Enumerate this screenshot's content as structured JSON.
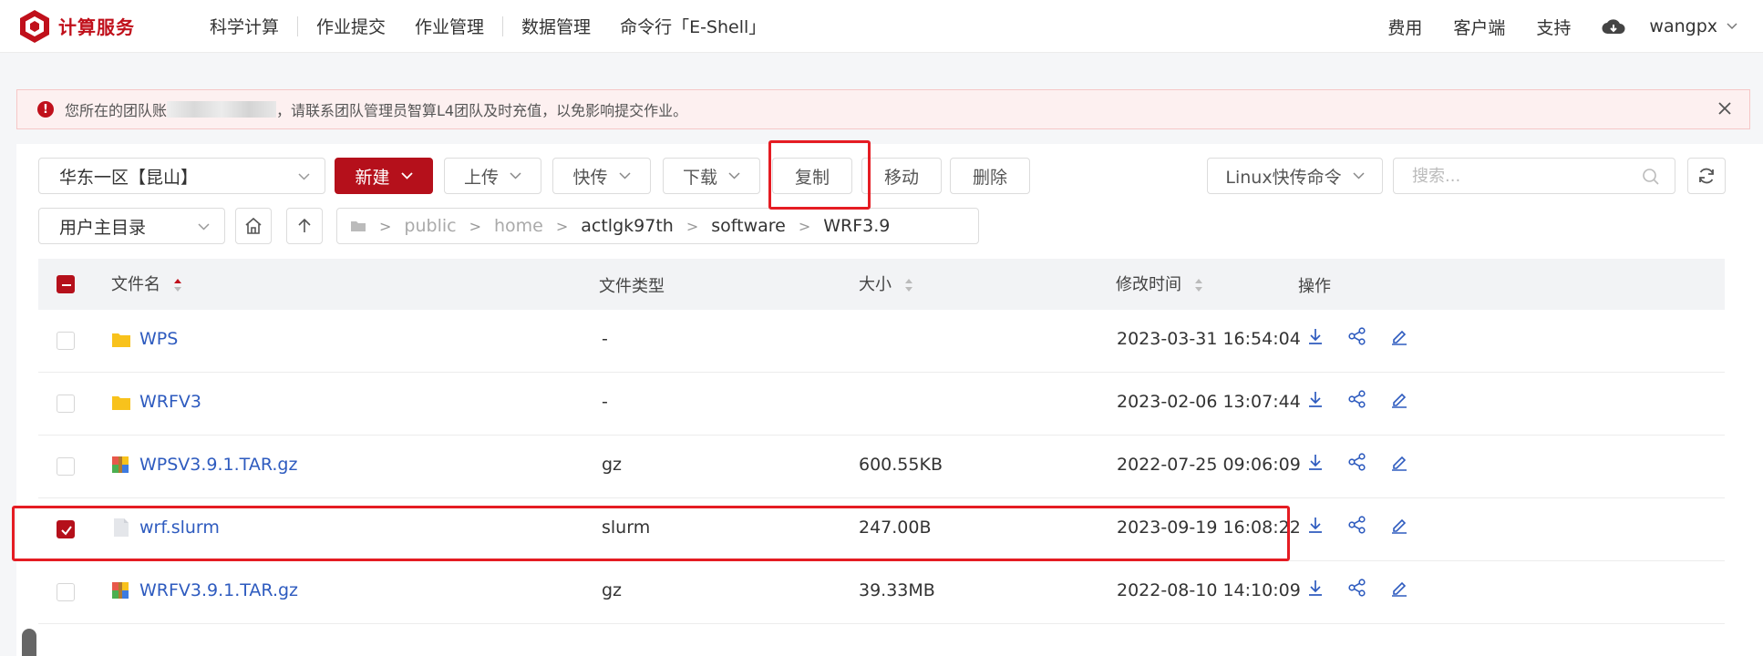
{
  "header": {
    "logo_text": "计算服务",
    "nav": [
      "科学计算",
      "作业提交",
      "作业管理",
      "数据管理",
      "命令行「E-Shell」"
    ],
    "right": [
      "费用",
      "客户端",
      "支持"
    ],
    "user": "wangpx"
  },
  "alert": {
    "text_before": "您所在的团队账",
    "text_after": "，请联系团队管理员智算L4团队及时充值，以免影响提交作业。"
  },
  "toolbar": {
    "region": "华东一区【昆山】",
    "new": "新建",
    "upload": "上传",
    "fast_transfer": "快传",
    "download": "下载",
    "copy": "复制",
    "move": "移动",
    "delete": "删除",
    "linux_cmd": "Linux快传命令",
    "search_placeholder": "搜索..."
  },
  "path_bar": {
    "dir_select": "用户主目录",
    "crumbs": [
      "public",
      "home",
      "actlgk97th",
      "software",
      "WRF3.9"
    ]
  },
  "table": {
    "headers": {
      "name": "文件名",
      "type": "文件类型",
      "size": "大小",
      "mtime": "修改时间",
      "ops": "操作"
    },
    "rows": [
      {
        "name": "WPS",
        "type": "-",
        "size": "",
        "mtime": "2023-03-31 16:54:04",
        "icon": "folder-icon",
        "checked": false
      },
      {
        "name": "WRFV3",
        "type": "-",
        "size": "",
        "mtime": "2023-02-06 13:07:44",
        "icon": "folder-icon",
        "checked": false
      },
      {
        "name": "WPSV3.9.1.TAR.gz",
        "type": "gz",
        "size": "600.55KB",
        "mtime": "2022-07-25 09:06:09",
        "icon": "archive-icon",
        "checked": false
      },
      {
        "name": "wrf.slurm",
        "type": "slurm",
        "size": "247.00B",
        "mtime": "2023-09-19 16:08:22",
        "icon": "file-icon",
        "checked": true
      },
      {
        "name": "WRFV3.9.1.TAR.gz",
        "type": "gz",
        "size": "39.33MB",
        "mtime": "2022-08-10 14:10:09",
        "icon": "archive-icon",
        "checked": false
      }
    ]
  },
  "colors": {
    "brand": "#b5101b",
    "link": "#2e5bbf",
    "highlight": "#e51c23"
  }
}
